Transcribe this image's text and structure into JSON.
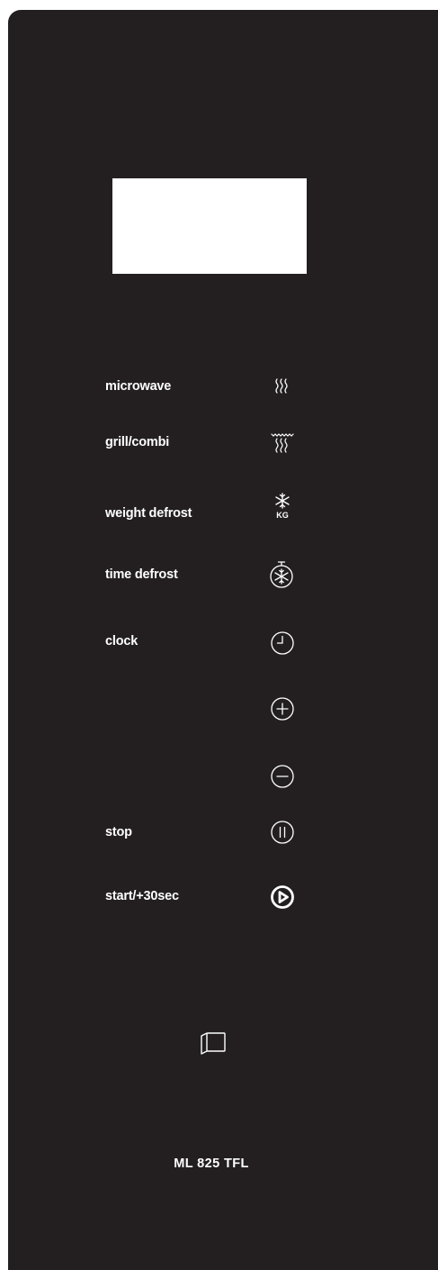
{
  "colors": {
    "panel_background": "#231f20",
    "display_background": "#ffffff",
    "text": "#ffffff"
  },
  "display": {
    "text": ""
  },
  "controls": [
    {
      "id": "microwave",
      "label": "microwave",
      "icon": "microwave-waves-icon"
    },
    {
      "id": "grill-combi",
      "label": "grill/combi",
      "icon": "grill-combi-icon"
    },
    {
      "id": "weight-defrost",
      "label": "weight defrost",
      "icon": "snowflake-kg-icon"
    },
    {
      "id": "time-defrost",
      "label": "time defrost",
      "icon": "snowflake-timer-icon"
    },
    {
      "id": "clock",
      "label": "clock",
      "icon": "clock-icon"
    },
    {
      "id": "plus",
      "label": "",
      "icon": "plus-circle-icon"
    },
    {
      "id": "minus",
      "label": "",
      "icon": "minus-circle-icon"
    },
    {
      "id": "stop",
      "label": "stop",
      "icon": "pause-circle-icon"
    },
    {
      "id": "start",
      "label": "start/+30sec",
      "icon": "play-circle-icon"
    }
  ],
  "door_button": {
    "icon": "door-open-icon"
  },
  "icon_text": {
    "kg": "KG"
  },
  "model": "ML 825 TFL"
}
